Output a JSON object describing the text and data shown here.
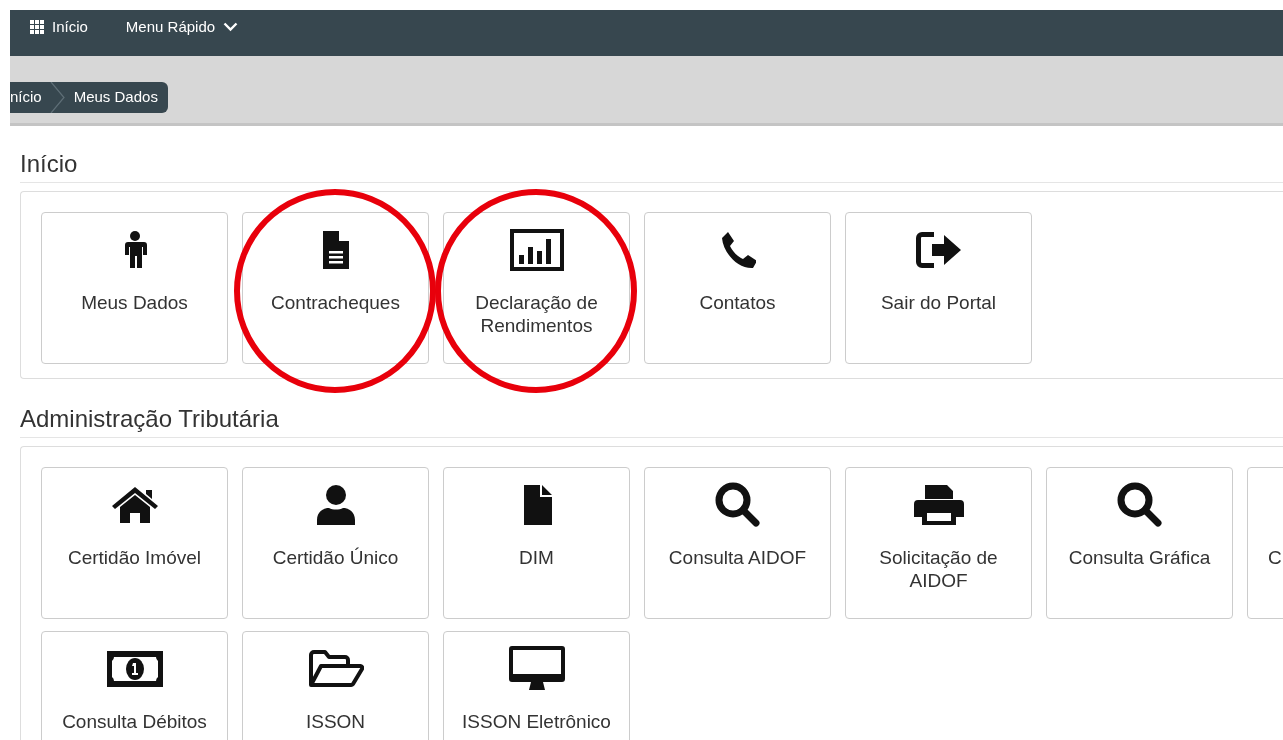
{
  "navbar": {
    "items": [
      {
        "kind": "home",
        "label": "Início"
      },
      {
        "kind": "dropdown",
        "label": "Menu Rápido"
      }
    ]
  },
  "breadcrumb": [
    "nício",
    "Meus Dados"
  ],
  "sections": [
    {
      "title": "Início",
      "tiles": [
        {
          "label": "Meus Dados",
          "circled": false
        },
        {
          "label": "Contracheques",
          "circled": true
        },
        {
          "label": "Declaração de Rendimentos",
          "circled": true
        },
        {
          "label": "Contatos",
          "circled": false
        },
        {
          "label": "Sair do Portal",
          "circled": false
        }
      ]
    },
    {
      "title": "Administração Tributária",
      "tiles": [
        {
          "label": "Certidão Imóvel",
          "circled": false
        },
        {
          "label": "Certidão Único",
          "circled": false
        },
        {
          "label": "DIM",
          "circled": false
        },
        {
          "label": "Consulta AIDOF",
          "circled": false
        },
        {
          "label": "Solicitação de AIDOF",
          "circled": false
        },
        {
          "label": "Consulta Gráfica",
          "circled": false
        },
        {
          "kind": "cut-off",
          "label": "C",
          "circled": false
        },
        {
          "label": "Consulta Débitos",
          "circled": false
        },
        {
          "label": "ISSON",
          "circled": false
        },
        {
          "label": "ISSON Eletrônico",
          "circled": false
        }
      ]
    }
  ]
}
